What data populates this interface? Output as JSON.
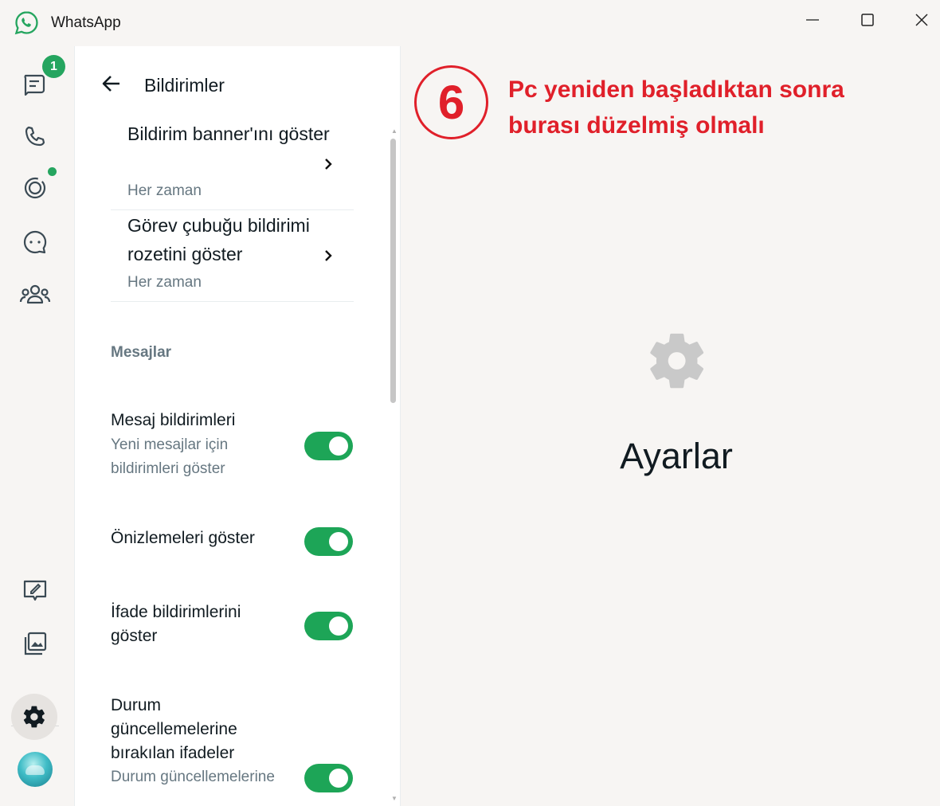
{
  "window": {
    "title": "WhatsApp"
  },
  "rail": {
    "chats_badge": "1"
  },
  "panel": {
    "title": "Bildirimler",
    "nav_items": [
      {
        "title": "Bildirim banner'ını göster",
        "value": "Her zaman"
      },
      {
        "title": "Görev çubuğu bildirimi rozetini göster",
        "value": "Her zaman"
      }
    ],
    "section_messages": "Mesajlar",
    "toggles": [
      {
        "title": "Mesaj bildirimleri",
        "subtitle": "Yeni mesajlar için bildirimleri göster",
        "on": true
      },
      {
        "title": "Önizlemeleri göster",
        "subtitle": "",
        "on": true
      },
      {
        "title": "İfade bildirimlerini göster",
        "subtitle": "",
        "on": true
      },
      {
        "title": "Durum güncellemelerine bırakılan ifadeler",
        "subtitle": "Durum güncellemelerine",
        "on": true
      }
    ]
  },
  "main": {
    "title": "Ayarlar"
  },
  "annotation": {
    "step": "6",
    "text": "Pc  yeniden başladıktan sonra burası düzelmiş olmalı"
  },
  "colors": {
    "accent": "#1da557",
    "annotation": "#e0202a",
    "muted": "#667781"
  }
}
